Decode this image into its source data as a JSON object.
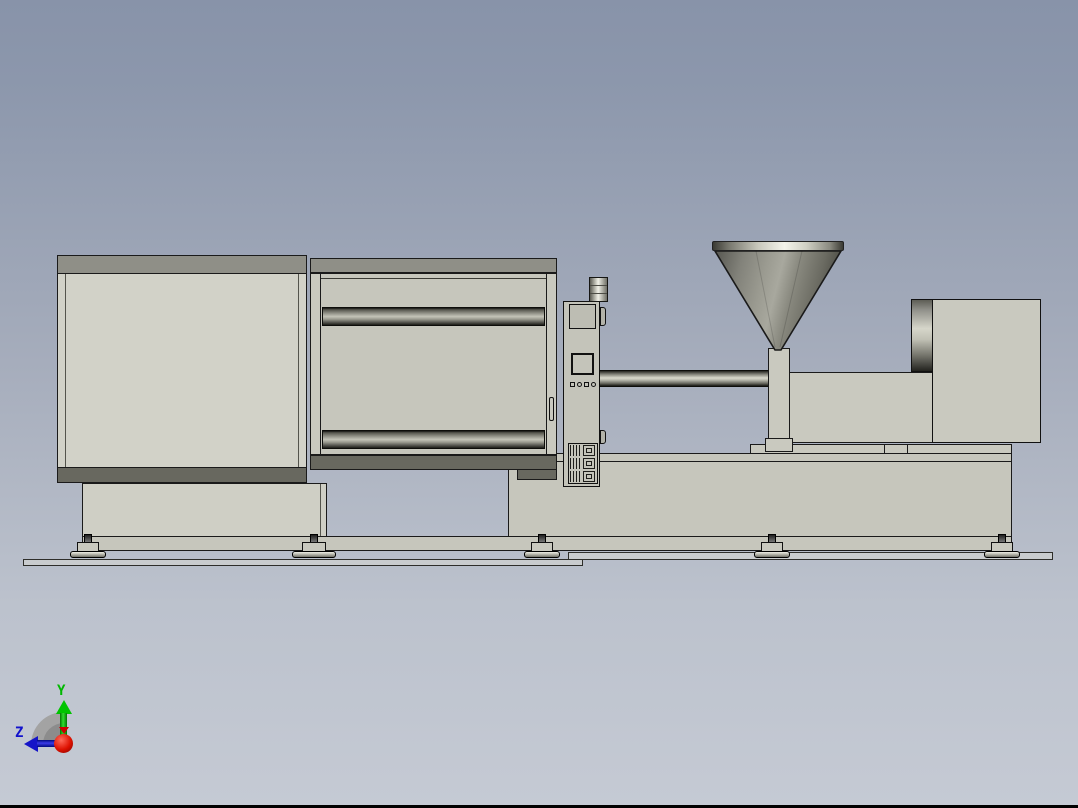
{
  "viewport": {
    "background_top": "#8893a9",
    "background_bottom": "#c5cad4",
    "bottom_edge_color": "#000000"
  },
  "axis_triad": {
    "y_label": "Y",
    "z_label": "Z",
    "y_axis_color": "#00b800",
    "z_axis_color": "#1111cc",
    "origin_x_color": "#dd1100",
    "shadow_color": "#a3a3a3"
  },
  "machine_colors": {
    "panel_light": "#d2d2c8",
    "panel_mid": "#c6c6bc",
    "body": "#c9c9bf",
    "band_top": "#8f8f87",
    "band_bottom": "#68685f",
    "outline": "#1a1a1a"
  }
}
